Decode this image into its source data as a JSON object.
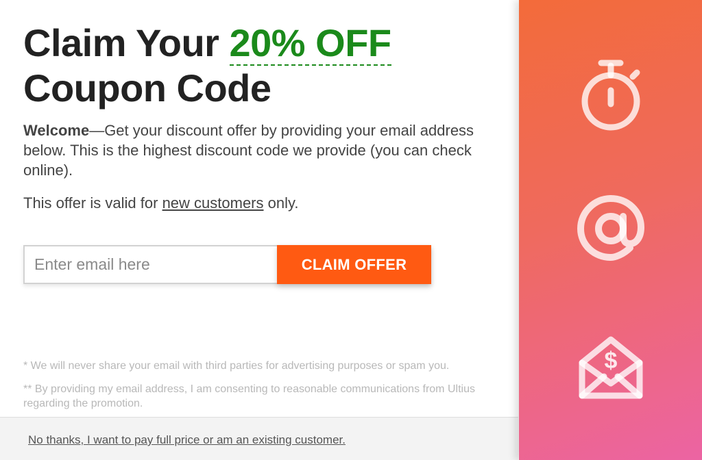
{
  "headline": {
    "prefix": "Claim Your ",
    "accent": "20% OFF",
    "line2": "Coupon Code"
  },
  "intro": {
    "bold": "Welcome",
    "text": "—Get your discount offer by providing your email address below. This is the highest discount code we provide (you can check online)."
  },
  "validity": {
    "before": "This offer is valid for ",
    "link": "new customers",
    "after": " only."
  },
  "form": {
    "email_placeholder": "Enter email here",
    "email_value": "",
    "button_label": "CLAIM OFFER"
  },
  "notes": {
    "privacy": "* We will never share your email with third parties for advertising purposes or spam you.",
    "consent": "** By providing my email address, I am consenting to reasonable communications from Ultius regarding the promotion."
  },
  "footer": {
    "decline_link": "No thanks, I want to pay full price or am an existing customer."
  },
  "side_panel": {
    "icons": [
      "stopwatch-icon",
      "at-sign-icon",
      "money-envelope-icon"
    ]
  },
  "colors": {
    "accent_green": "#1b8a1b",
    "cta_orange": "#ff5a12",
    "panel_gradient_top": "#f36b3a",
    "panel_gradient_bottom": "#ec64a3"
  }
}
